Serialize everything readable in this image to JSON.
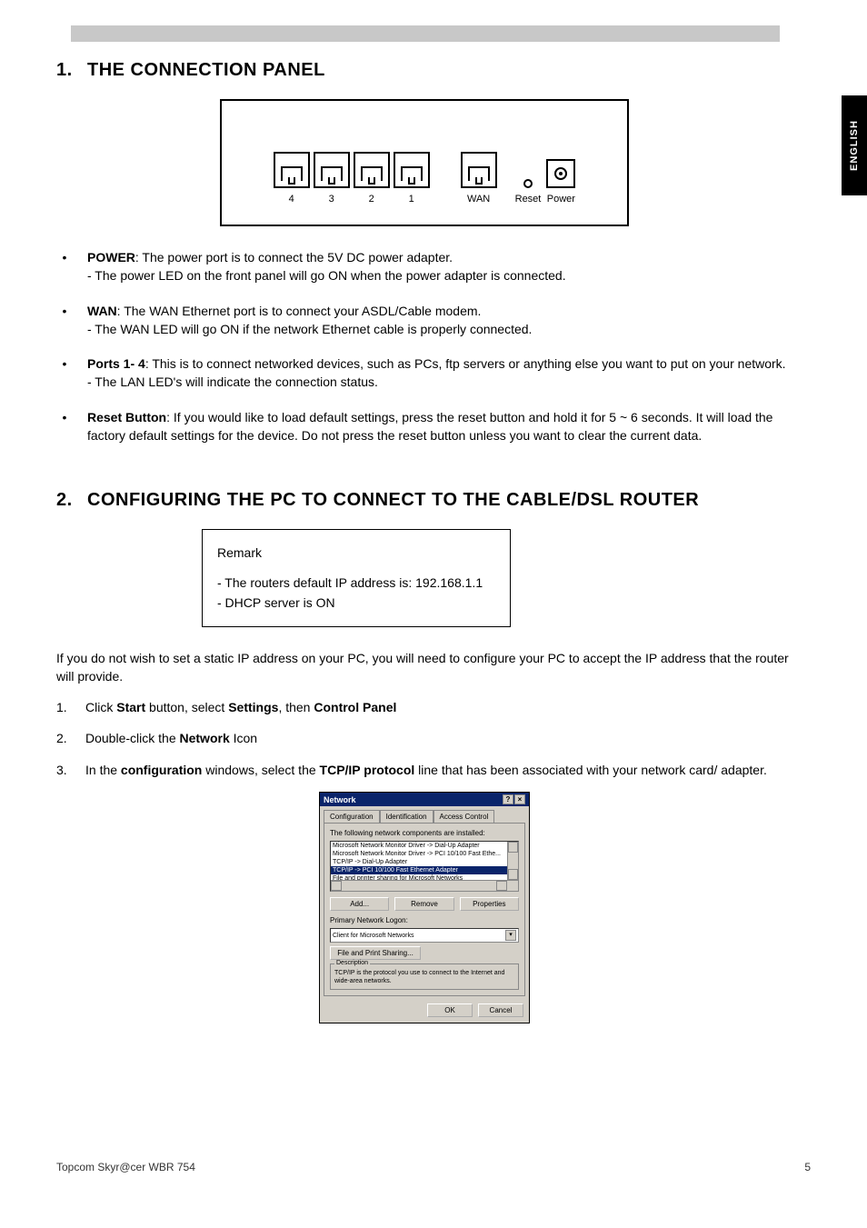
{
  "page": {
    "side_tab": "ENGLISH",
    "footer_left": "Topcom Skyr@cer WBR 754",
    "footer_right": "5"
  },
  "section1": {
    "number": "1.",
    "title": "THE CONNECTION PANEL",
    "port_labels": {
      "p4": "4",
      "p3": "3",
      "p2": "2",
      "p1": "1",
      "wan": "WAN",
      "reset": "Reset",
      "power": "Power"
    },
    "bullets": [
      {
        "bold": "POWER",
        "text": ": The power port is to connect the 5V DC power adapter.",
        "sub": "- The power LED on the front panel will go ON when the power adapter is connected."
      },
      {
        "bold": "WAN",
        "text": ": The WAN Ethernet port is to connect your ASDL/Cable modem.",
        "sub": "- The WAN LED will go ON if the network Ethernet cable is properly connected."
      },
      {
        "bold": "Ports 1- 4",
        "text": ": This is to connect networked devices, such as PCs, ftp servers or anything else you want to put on your network.",
        "sub": "- The LAN LED's will indicate the connection status."
      },
      {
        "bold": "Reset Button",
        "text": ": If you would like to load default settings, press the reset button and hold it for 5 ~ 6 seconds. It will load the factory default settings for the device. Do not press the reset button unless you want to clear the current data.",
        "sub": ""
      }
    ]
  },
  "section2": {
    "number": "2.",
    "title": "CONFIGURING THE PC TO CONNECT TO THE CABLE/DSL ROUTER",
    "remark": {
      "heading": "Remark",
      "line1": "- The routers default IP address is: 192.168.1.1",
      "line2": "- DHCP server is ON"
    },
    "paragraph": "If you do not wish to set a static IP address on your PC, you will need to configure your PC to accept the IP address that the router will provide.",
    "steps": [
      {
        "n": "1.",
        "before": "Click ",
        "b1": "Start",
        "mid1": " button, select ",
        "b2": "Settings",
        "mid2": ", then ",
        "b3": "Control Panel",
        "after": ""
      },
      {
        "n": "2.",
        "before": "Double-click the ",
        "b1": "Network",
        "mid1": " Icon",
        "b2": "",
        "mid2": "",
        "b3": "",
        "after": ""
      },
      {
        "n": "3.",
        "before": "In the ",
        "b1": "configuration",
        "mid1": " windows, select the ",
        "b2": "TCP/IP protocol",
        "mid2": " line that has been associated with your network card/ adapter.",
        "b3": "",
        "after": ""
      }
    ]
  },
  "dialog": {
    "title": "Network",
    "tabs": {
      "t1": "Configuration",
      "t2": "Identification",
      "t3": "Access Control"
    },
    "caption": "The following network components are installed:",
    "list": {
      "row1": "Microsoft Network Monitor Driver -> Dial-Up Adapter",
      "row2": "Microsoft Network Monitor Driver -> PCI 10/100 Fast Ethe...",
      "row3": "TCP/IP -> Dial-Up Adapter",
      "row4": "TCP/IP -> PCI 10/100 Fast Ethernet Adapter",
      "row5": "File and printer sharing for Microsoft Networks"
    },
    "buttons": {
      "add": "Add...",
      "remove": "Remove",
      "properties": "Properties"
    },
    "logon_label": "Primary Network Logon:",
    "logon_value": "Client for Microsoft Networks",
    "file_share": "File and Print Sharing...",
    "desc_legend": "Description",
    "desc_text": "TCP/IP is the protocol you use to connect to the Internet and wide-area networks.",
    "ok": "OK",
    "cancel": "Cancel",
    "help_glyph": "?",
    "close_glyph": "×",
    "drop_glyph": "▾"
  }
}
